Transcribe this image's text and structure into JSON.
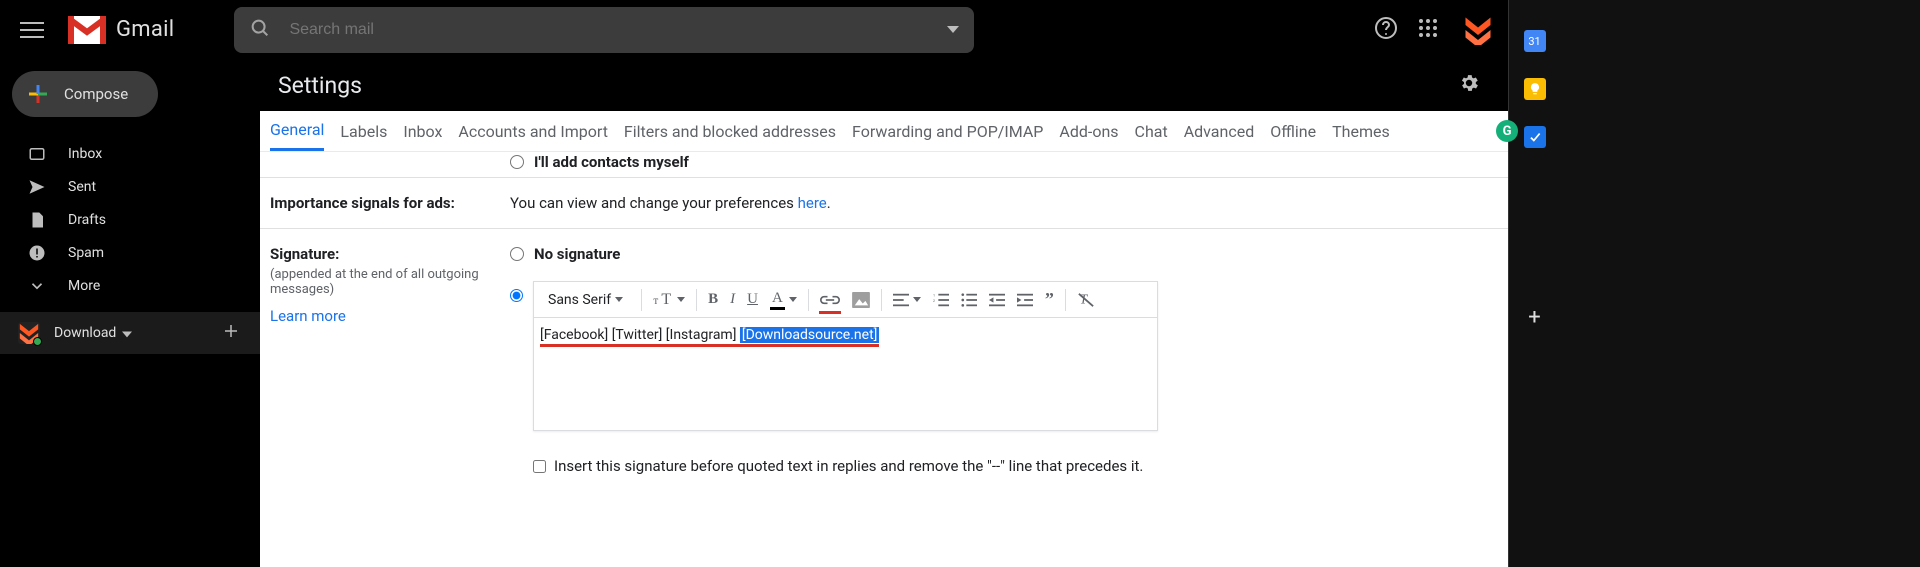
{
  "header": {
    "brand_text": "Gmail",
    "search_placeholder": "Search mail"
  },
  "sidebar": {
    "compose": "Compose",
    "folders": [
      {
        "icon": "inbox",
        "label": "Inbox"
      },
      {
        "icon": "sent",
        "label": "Sent"
      },
      {
        "icon": "drafts",
        "label": "Drafts"
      },
      {
        "icon": "spam",
        "label": "Spam"
      },
      {
        "icon": "more",
        "label": "More"
      }
    ],
    "account": {
      "name": "Download"
    }
  },
  "page_title": "Settings",
  "tabs": [
    "General",
    "Labels",
    "Inbox",
    "Accounts and Import",
    "Filters and blocked addresses",
    "Forwarding and POP/IMAP",
    "Add-ons",
    "Chat",
    "Advanced",
    "Offline",
    "Themes"
  ],
  "active_tab_index": 0,
  "rows": {
    "cutoff_radio_label": "I'll add contacts myself",
    "importance": {
      "title": "Importance signals for ads:",
      "text_before": "You can view and change your preferences ",
      "link_text": "here",
      "text_after": "."
    },
    "signature": {
      "title": "Signature:",
      "sub": "(appended at the end of all outgoing messages)",
      "learn_more": "Learn more",
      "no_sig": "No signature",
      "toolbar_font": "Sans Serif",
      "text_plain": "[Facebook] [Twitter] [Instagram] ",
      "text_selected": "[Downloadsource.net]",
      "insert_checkbox": "Insert this signature before quoted text in replies and remove the \"--\" line that precedes it."
    }
  },
  "rail": {
    "calendar_day": "31"
  }
}
